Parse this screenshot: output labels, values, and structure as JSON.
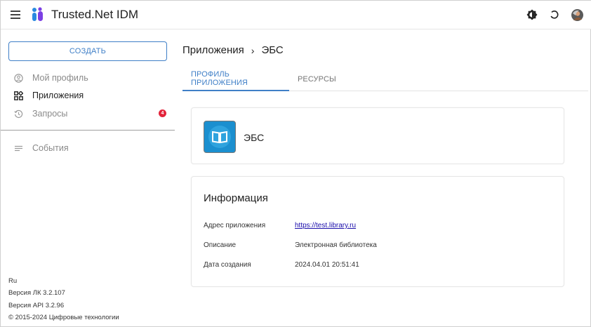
{
  "app": {
    "title": "Trusted.Net IDM"
  },
  "sidebar": {
    "create_label": "СОЗДАТЬ",
    "items": [
      {
        "label": "Мой профиль",
        "icon": "user-circle-icon"
      },
      {
        "label": "Приложения",
        "icon": "apps-grid-icon"
      },
      {
        "label": "Запросы",
        "icon": "history-icon",
        "badge": "4"
      },
      {
        "label": "События",
        "icon": "list-icon"
      }
    ],
    "footer": {
      "lang": "Ru",
      "lk_version": "Версия ЛК 3.2.107",
      "api_version": "Версия API 3.2.96",
      "copyright": "© 2015-2024 Цифровые технологии"
    }
  },
  "breadcrumb": {
    "parent": "Приложения",
    "separator": "›",
    "current": "ЭБС"
  },
  "tabs": [
    {
      "label": "ПРОФИЛЬ ПРИЛОЖЕНИЯ",
      "active": true
    },
    {
      "label": "РЕСУРСЫ",
      "active": false
    }
  ],
  "application": {
    "name": "ЭБС",
    "icon": "book-icon",
    "icon_bg": "#1b8fcf"
  },
  "info": {
    "title": "Информация",
    "rows": [
      {
        "label": "Адрес приложения",
        "value": "https://test.library.ru",
        "link": true
      },
      {
        "label": "Описание",
        "value": "Электронная библиотека"
      },
      {
        "label": "Дата создания",
        "value": "2024.04.01 20:51:41"
      }
    ]
  },
  "colors": {
    "accent": "#3f7fc7",
    "badge": "#e3243b",
    "link": "#1a0dab"
  }
}
